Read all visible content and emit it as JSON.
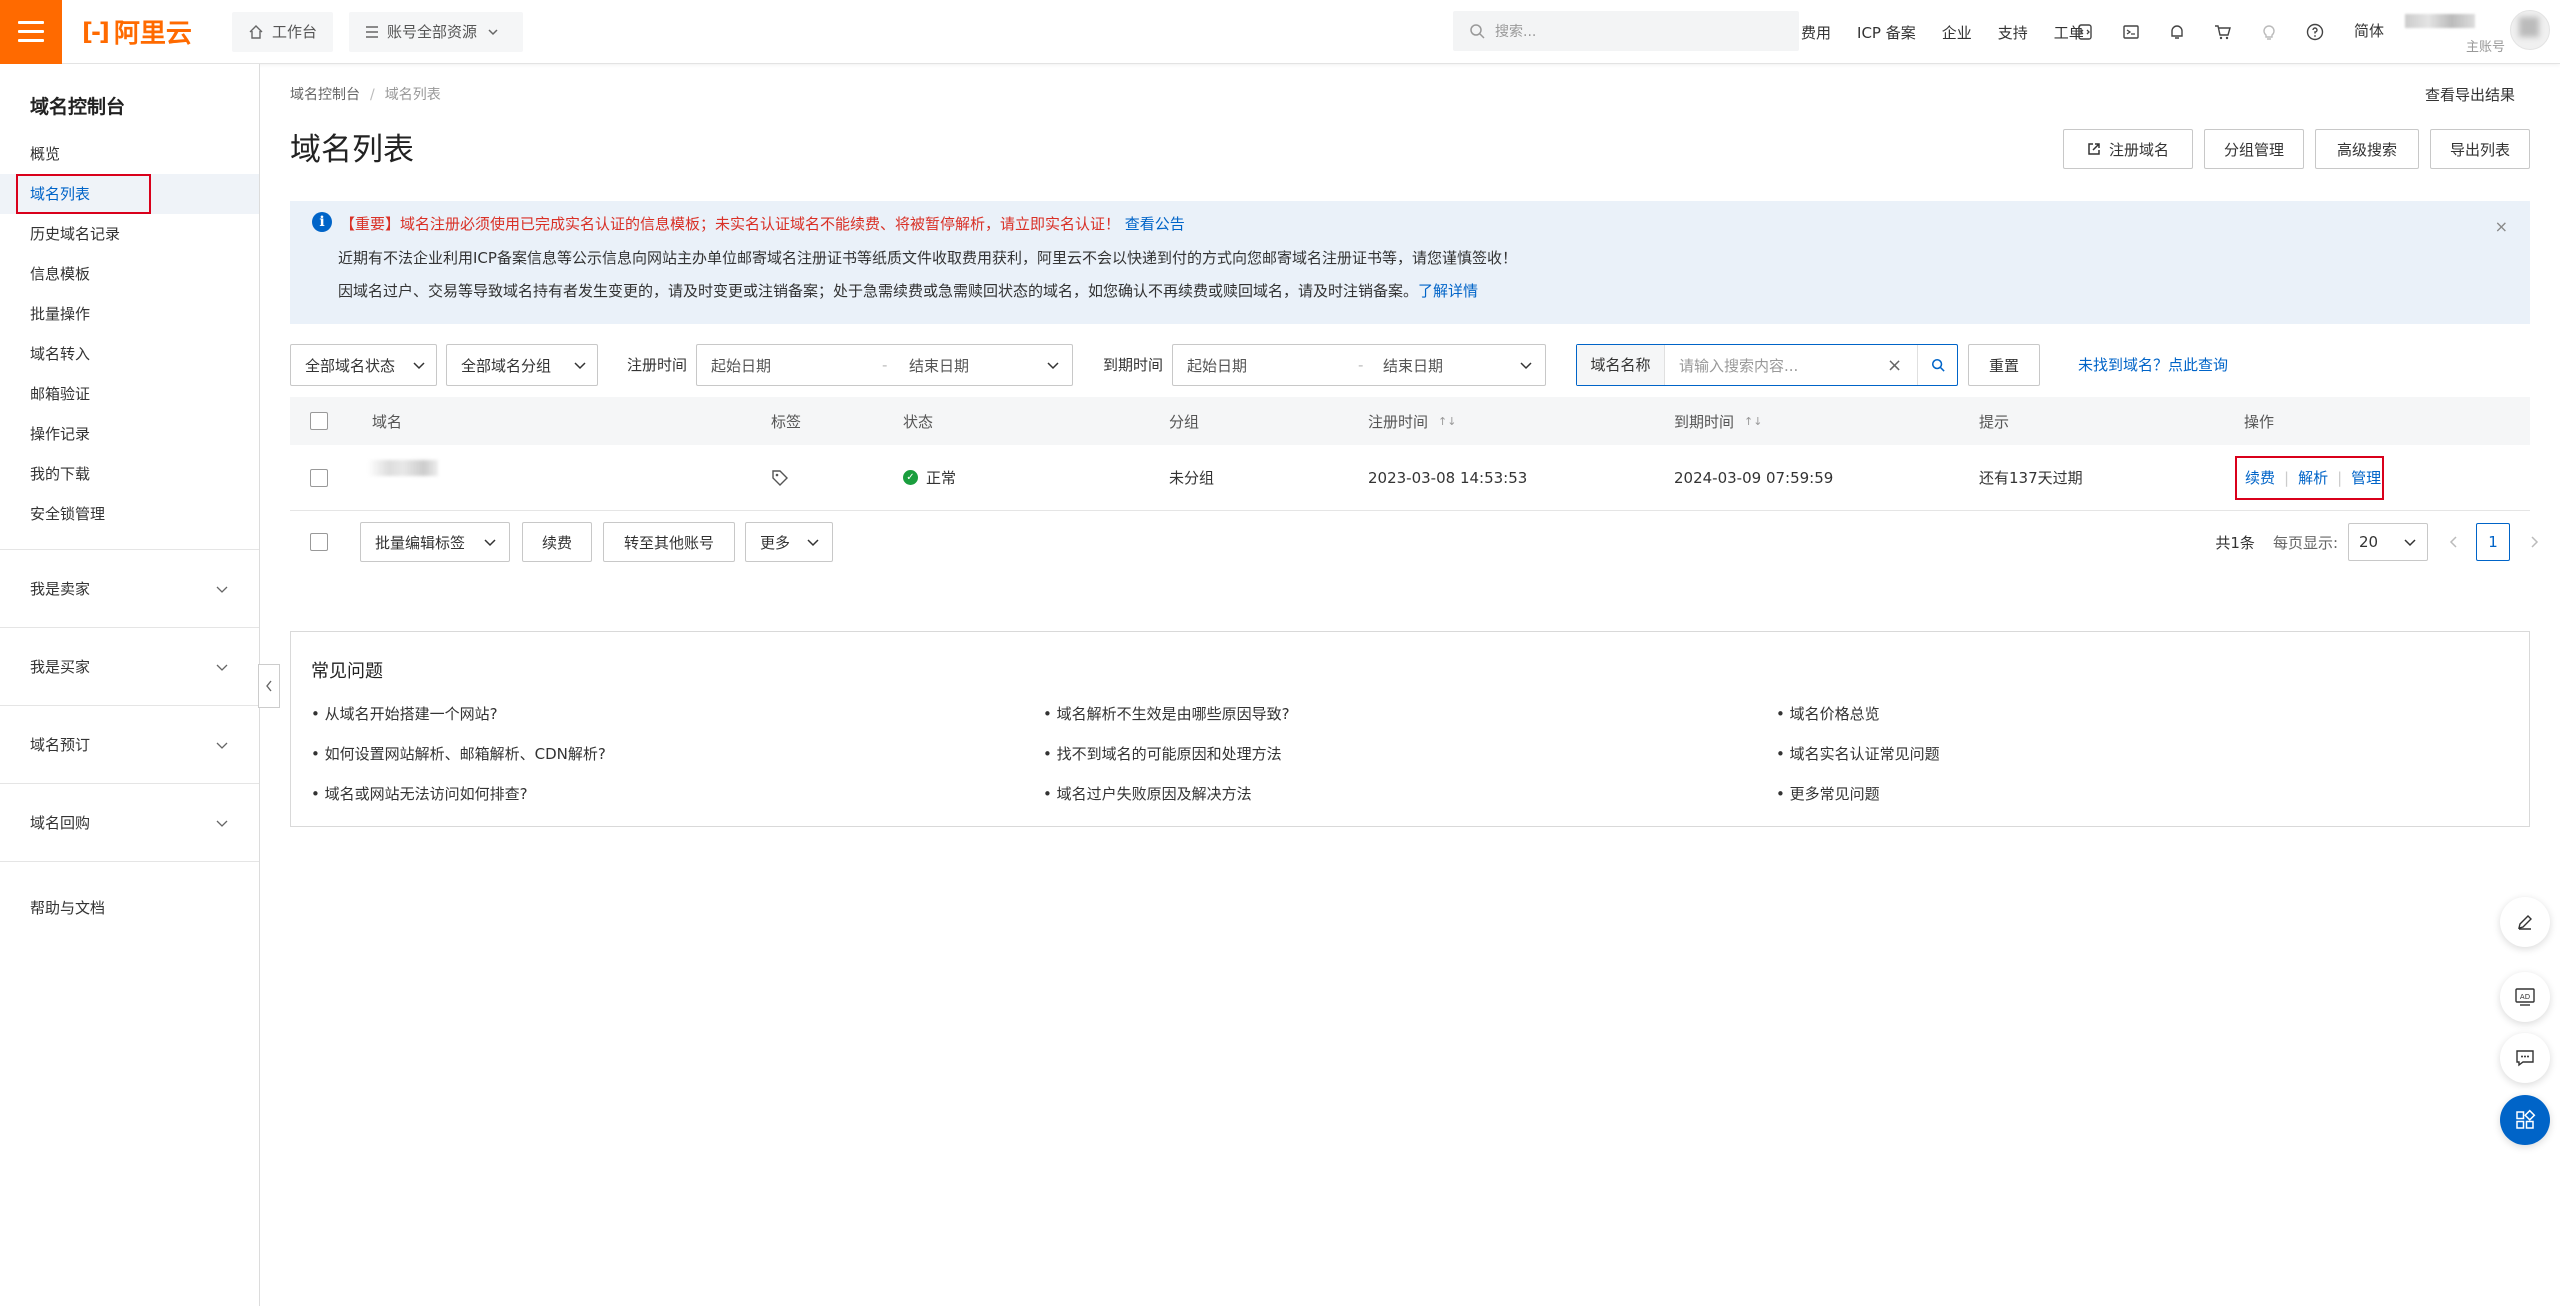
{
  "topbar": {
    "brand": "阿里云",
    "workspace": "工作台",
    "resources": "账号全部资源",
    "search_placeholder": "搜索...",
    "nav": [
      "费用",
      "ICP 备案",
      "企业",
      "支持",
      "工单"
    ],
    "lang": "简体",
    "account_role": "主账号",
    "accent": "#ff6a00"
  },
  "sidebar": {
    "title": "域名控制台",
    "items": [
      "概览",
      "域名列表",
      "历史域名记录",
      "信息模板",
      "批量操作",
      "域名转入",
      "邮箱验证",
      "操作记录",
      "我的下载",
      "安全锁管理"
    ],
    "groups": [
      "我是卖家",
      "我是买家",
      "域名预订",
      "域名回购"
    ],
    "help": "帮助与文档"
  },
  "header": {
    "crumb_root": "域名控制台",
    "crumb_current": "域名列表",
    "title": "域名列表",
    "export_result": "查看导出结果",
    "buttons": [
      "注册域名",
      "分组管理",
      "高级搜索",
      "导出列表"
    ]
  },
  "notice": {
    "line1_red": "【重要】域名注册必须使用已完成实名认证的信息模板；未实名认证域名不能续费、将被暂停解析，请立即实名认证！",
    "line1_link": "查看公告",
    "line2": "近期有不法企业利用ICP备案信息等公示信息向网站主办单位邮寄域名注册证书等纸质文件收取费用获利，阿里云不会以快递到付的方式向您邮寄域名注册证书等，请您谨慎签收！",
    "line3": "因域名过户、交易等导致域名持有者发生变更的，请及时变更或注销备案；处于急需续费或急需赎回状态的域名，如您确认不再续费或赎回域名，请及时注销备案。",
    "line3_link": "了解详情"
  },
  "filters": {
    "status": "全部域名状态",
    "group": "全部域名分组",
    "reg_label": "注册时间",
    "exp_label": "到期时间",
    "start": "起始日期",
    "end": "结束日期",
    "search_key": "域名名称",
    "search_placeholder": "请输入搜索内容...",
    "reset": "重置",
    "not_found": "未找到域名？点此查询"
  },
  "table": {
    "headers": [
      "域名",
      "标签",
      "状态",
      "分组",
      "注册时间",
      "到期时间",
      "提示",
      "操作"
    ],
    "row": {
      "status": "正常",
      "group": "未分组",
      "registered": "2023-03-08 14:53:53",
      "expires": "2024-03-09 07:59:59",
      "hint": "还有137天过期",
      "actions": [
        "续费",
        "解析",
        "管理"
      ]
    }
  },
  "bulk": {
    "edit_tags": "批量编辑标签",
    "renew": "续费",
    "transfer": "转至其他账号",
    "more": "更多",
    "total": "共1条",
    "per_page_label": "每页显示:",
    "per_page": "20",
    "page": "1"
  },
  "faq": {
    "title": "常见问题",
    "items": [
      "从域名开始搭建一个网站?",
      "域名解析不生效是由哪些原因导致?",
      "域名价格总览",
      "如何设置网站解析、邮箱解析、CDN解析?",
      "找不到域名的可能原因和处理方法",
      "域名实名认证常见问题",
      "域名或网站无法访问如何排查?",
      "域名过户失败原因及解决方法",
      "更多常见问题"
    ]
  }
}
